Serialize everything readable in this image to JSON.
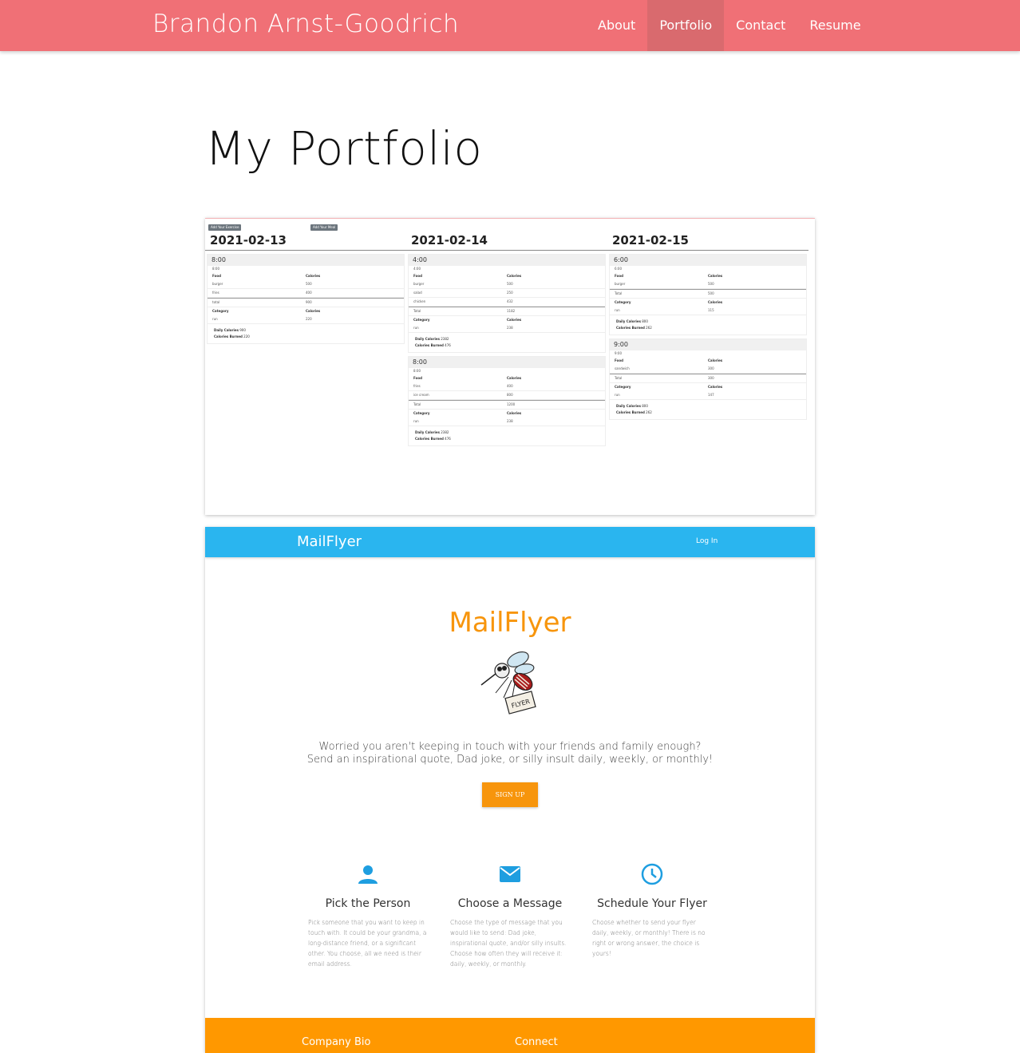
{
  "nav": {
    "brand": "Brandon Arnst-Goodrich",
    "links": [
      "About",
      "Portfolio",
      "Contact",
      "Resume"
    ],
    "active": "Portfolio"
  },
  "page_title": "My Portfolio",
  "calendar": {
    "buttons": [
      "Add Your Exercise",
      "Add Your Meal"
    ],
    "days": [
      {
        "date": "2021-02-13",
        "entries": [
          {
            "time": "8:00",
            "sub_time": "8:00",
            "food_header": [
              "Food",
              "Calories"
            ],
            "foods": [
              [
                "burger",
                "500"
              ],
              [
                "fries",
                "400"
              ]
            ],
            "total": [
              "total",
              "900"
            ],
            "cat_header": [
              "Category",
              "Calories"
            ],
            "cats": [
              [
                "run",
                "220"
              ]
            ],
            "daily_calories": "900",
            "calories_burned": "220"
          }
        ]
      },
      {
        "date": "2021-02-14",
        "entries": [
          {
            "time": "4:00",
            "sub_time": "4:00",
            "food_header": [
              "Food",
              "Calories"
            ],
            "foods": [
              [
                "burger",
                "500"
              ],
              [
                "salad",
                "250"
              ],
              [
                "chicken",
                "432"
              ]
            ],
            "total": [
              "Total",
              "1182"
            ],
            "cat_header": [
              "Category",
              "Calories"
            ],
            "cats": [
              [
                "run",
                "238"
              ]
            ],
            "daily_calories": "2382",
            "calories_burned": "476"
          },
          {
            "time": "8:00",
            "sub_time": "8:00",
            "food_header": [
              "Food",
              "Calories"
            ],
            "foods": [
              [
                "fries",
                "400"
              ],
              [
                "ice cream",
                "800"
              ]
            ],
            "total": [
              "Total",
              "1200"
            ],
            "cat_header": [
              "Category",
              "Calories"
            ],
            "cats": [
              [
                "run",
                "238"
              ]
            ],
            "daily_calories": "2382",
            "calories_burned": "476"
          }
        ]
      },
      {
        "date": "2021-02-15",
        "entries": [
          {
            "time": "6:00",
            "sub_time": "6:00",
            "food_header": [
              "Food",
              "Calories"
            ],
            "foods": [
              [
                "burger",
                "500"
              ]
            ],
            "total": [
              "Total",
              "500"
            ],
            "cat_header": [
              "Category",
              "Calories"
            ],
            "cats": [
              [
                "run",
                "115"
              ]
            ],
            "daily_calories": "800",
            "calories_burned": "262"
          },
          {
            "time": "9:00",
            "sub_time": "9:00",
            "food_header": [
              "Food",
              "Calories"
            ],
            "foods": [
              [
                "sandwich",
                "300"
              ]
            ],
            "total": [
              "Total",
              "300"
            ],
            "cat_header": [
              "Category",
              "Calories"
            ],
            "cats": [
              [
                "run",
                "147"
              ]
            ],
            "daily_calories": "800",
            "calories_burned": "262"
          }
        ]
      }
    ],
    "labels": {
      "daily": "Daily Calories",
      "burned": "Calories Burned"
    }
  },
  "mailflyer": {
    "nav_brand": "MailFlyer",
    "login": "Log In",
    "hero_title": "MailFlyer",
    "tagline_1": "Worried you aren't keeping in touch with your friends and family enough?",
    "tagline_2": "Send an inspirational quote, Dad joke, or silly insult daily, weekly, or monthly!",
    "signup": "SIGN UP",
    "logo_text": "FLYER",
    "features": [
      {
        "icon": "person-icon",
        "title": "Pick the Person",
        "body": "Pick someone that you want to keep in touch with. It could be your grandma, a long-distance friend, or a significant other. You choose, all we need is their email address."
      },
      {
        "icon": "mail-icon",
        "title": "Choose a Message",
        "body": "Choose the type of message that you would like to send: Dad joke, inspirational quote, and/or silly insults. Choose how often they will receive it: daily, weekly, or monthly."
      },
      {
        "icon": "clock-icon",
        "title": "Schedule Your Flyer",
        "body": "Choose whether to send your flyer daily, weekly, or monthly! There is no right or wrong answer, the choice is yours!"
      }
    ],
    "footer": [
      "Company Bio",
      "Connect"
    ],
    "colors": {
      "navbar": "#2ab5ef",
      "accent": "#f7950c",
      "footer": "#ff9800",
      "icon": "#1e9ee0"
    }
  }
}
